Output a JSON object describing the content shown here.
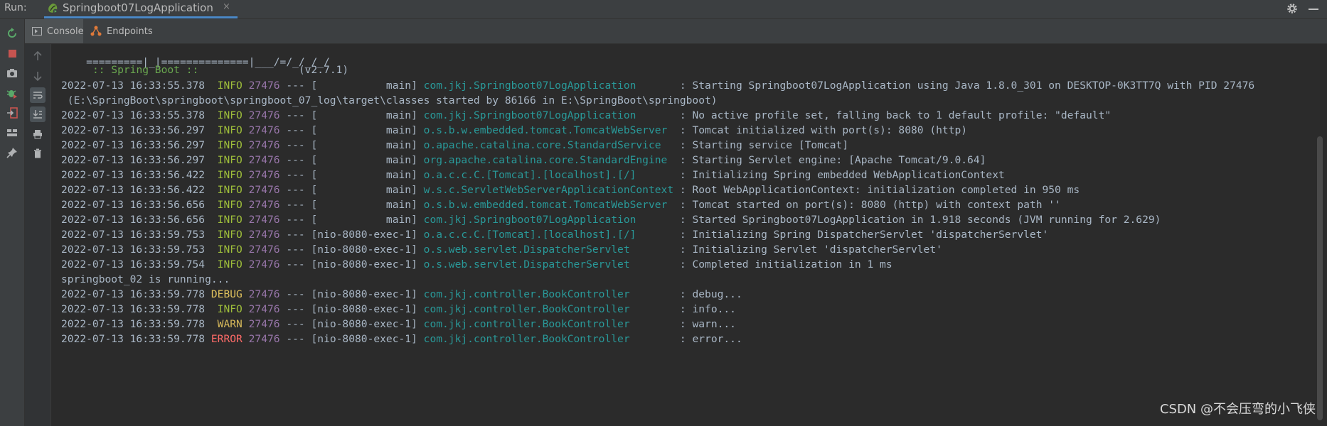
{
  "titlebar": {
    "run_label": "Run:",
    "tab_title": "Springboot07LogApplication",
    "tab_close": "×"
  },
  "subtabs": [
    {
      "label": "Console",
      "icon": "console-icon"
    },
    {
      "label": "Endpoints",
      "icon": "endpoints-icon"
    }
  ],
  "banner": {
    "line1": "=========|_|==============|___/=/_/_/_/",
    "line2_prefix": " :: Spring Boot :: ",
    "line2_version": "               (v2.7.1)"
  },
  "log": [
    {
      "ts": "2022-07-13 16:33:55.378",
      "level": " INFO",
      "pid": "27476",
      "sep": " --- [           main] ",
      "logger": "com.jkj.Springboot07LogApplication       ",
      "msg": ": Starting Springboot07LogApplication using Java 1.8.0_301 on DESKTOP-0K3TT7Q with PID 27476"
    },
    {
      "plain": " (E:\\SpringBoot\\springboot\\springboot_07_log\\target\\classes started by 86166 in E:\\SpringBoot\\springboot)"
    },
    {
      "ts": "2022-07-13 16:33:55.378",
      "level": " INFO",
      "pid": "27476",
      "sep": " --- [           main] ",
      "logger": "com.jkj.Springboot07LogApplication       ",
      "msg": ": No active profile set, falling back to 1 default profile: \"default\""
    },
    {
      "ts": "2022-07-13 16:33:56.297",
      "level": " INFO",
      "pid": "27476",
      "sep": " --- [           main] ",
      "logger": "o.s.b.w.embedded.tomcat.TomcatWebServer  ",
      "msg": ": Tomcat initialized with port(s): 8080 (http)"
    },
    {
      "ts": "2022-07-13 16:33:56.297",
      "level": " INFO",
      "pid": "27476",
      "sep": " --- [           main] ",
      "logger": "o.apache.catalina.core.StandardService   ",
      "msg": ": Starting service [Tomcat]"
    },
    {
      "ts": "2022-07-13 16:33:56.297",
      "level": " INFO",
      "pid": "27476",
      "sep": " --- [           main] ",
      "logger": "org.apache.catalina.core.StandardEngine  ",
      "msg": ": Starting Servlet engine: [Apache Tomcat/9.0.64]"
    },
    {
      "ts": "2022-07-13 16:33:56.422",
      "level": " INFO",
      "pid": "27476",
      "sep": " --- [           main] ",
      "logger": "o.a.c.c.C.[Tomcat].[localhost].[/]       ",
      "msg": ": Initializing Spring embedded WebApplicationContext"
    },
    {
      "ts": "2022-07-13 16:33:56.422",
      "level": " INFO",
      "pid": "27476",
      "sep": " --- [           main] ",
      "logger": "w.s.c.ServletWebServerApplicationContext ",
      "msg": ": Root WebApplicationContext: initialization completed in 950 ms"
    },
    {
      "ts": "2022-07-13 16:33:56.656",
      "level": " INFO",
      "pid": "27476",
      "sep": " --- [           main] ",
      "logger": "o.s.b.w.embedded.tomcat.TomcatWebServer  ",
      "msg": ": Tomcat started on port(s): 8080 (http) with context path ''"
    },
    {
      "ts": "2022-07-13 16:33:56.656",
      "level": " INFO",
      "pid": "27476",
      "sep": " --- [           main] ",
      "logger": "com.jkj.Springboot07LogApplication       ",
      "msg": ": Started Springboot07LogApplication in 1.918 seconds (JVM running for 2.629)"
    },
    {
      "ts": "2022-07-13 16:33:59.753",
      "level": " INFO",
      "pid": "27476",
      "sep": " --- [nio-8080-exec-1] ",
      "logger": "o.a.c.c.C.[Tomcat].[localhost].[/]       ",
      "msg": ": Initializing Spring DispatcherServlet 'dispatcherServlet'"
    },
    {
      "ts": "2022-07-13 16:33:59.753",
      "level": " INFO",
      "pid": "27476",
      "sep": " --- [nio-8080-exec-1] ",
      "logger": "o.s.web.servlet.DispatcherServlet        ",
      "msg": ": Initializing Servlet 'dispatcherServlet'"
    },
    {
      "ts": "2022-07-13 16:33:59.754",
      "level": " INFO",
      "pid": "27476",
      "sep": " --- [nio-8080-exec-1] ",
      "logger": "o.s.web.servlet.DispatcherServlet        ",
      "msg": ": Completed initialization in 1 ms"
    },
    {
      "plain": "springboot_02 is running..."
    },
    {
      "ts": "2022-07-13 16:33:59.778",
      "level": "DEBUG",
      "pid": "27476",
      "sep": " --- [nio-8080-exec-1] ",
      "logger": "com.jkj.controller.BookController        ",
      "msg": ": debug..."
    },
    {
      "ts": "2022-07-13 16:33:59.778",
      "level": " INFO",
      "pid": "27476",
      "sep": " --- [nio-8080-exec-1] ",
      "logger": "com.jkj.controller.BookController        ",
      "msg": ": info..."
    },
    {
      "ts": "2022-07-13 16:33:59.778",
      "level": " WARN",
      "pid": "27476",
      "sep": " --- [nio-8080-exec-1] ",
      "logger": "com.jkj.controller.BookController        ",
      "msg": ": warn..."
    },
    {
      "ts": "2022-07-13 16:33:59.778",
      "level": "ERROR",
      "pid": "27476",
      "sep": " --- [nio-8080-exec-1] ",
      "logger": "com.jkj.controller.BookController        ",
      "msg": ": error..."
    }
  ],
  "watermark": "CSDN @不会压弯的小飞侠"
}
